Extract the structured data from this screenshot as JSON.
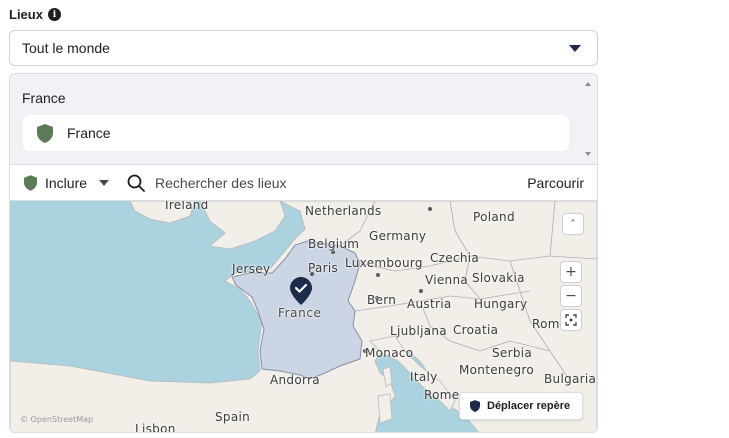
{
  "locations_label": "Lieux",
  "audience_select": {
    "value": "Tout le monde"
  },
  "location_list": {
    "group_title": "France",
    "items": [
      {
        "name": "France"
      }
    ]
  },
  "search_bar": {
    "include_label": "Inclure",
    "search_placeholder": "Rechercher des lieux",
    "browse_label": "Parcourir"
  },
  "map": {
    "labels": {
      "ireland": "Ireland",
      "netherlands": "Netherlands",
      "poland": "Poland",
      "belgium": "Belgium",
      "germany": "Germany",
      "jersey": "Jersey",
      "paris": "Paris",
      "luxembourg": "Luxembourg",
      "czechia": "Czechia",
      "vienna": "Vienna",
      "slovakia": "Slovakia",
      "bern": "Bern",
      "austria": "Austria",
      "hungary": "Hungary",
      "france": "France",
      "ljubljana": "Ljubljana",
      "croatia": "Croatia",
      "romania": "Rom",
      "monaco": "Monaco",
      "serbia": "Serbia",
      "italy": "Italy",
      "montenegro": "Montenegro",
      "andorra": "Andorra",
      "bulgaria": "Bulgaria",
      "rome": "Rome",
      "spain": "Spain",
      "lisbon": "Lisbon"
    },
    "attribution": "© OpenStreetMap",
    "zoom_in": "+",
    "zoom_out": "−",
    "scroll_up": "˄",
    "move_pin_label": "Déplacer repère"
  },
  "colors": {
    "shield_green": "#5b7b56",
    "pin_navy": "#1c2b4a",
    "highlight_region": "#c9d4e3"
  }
}
